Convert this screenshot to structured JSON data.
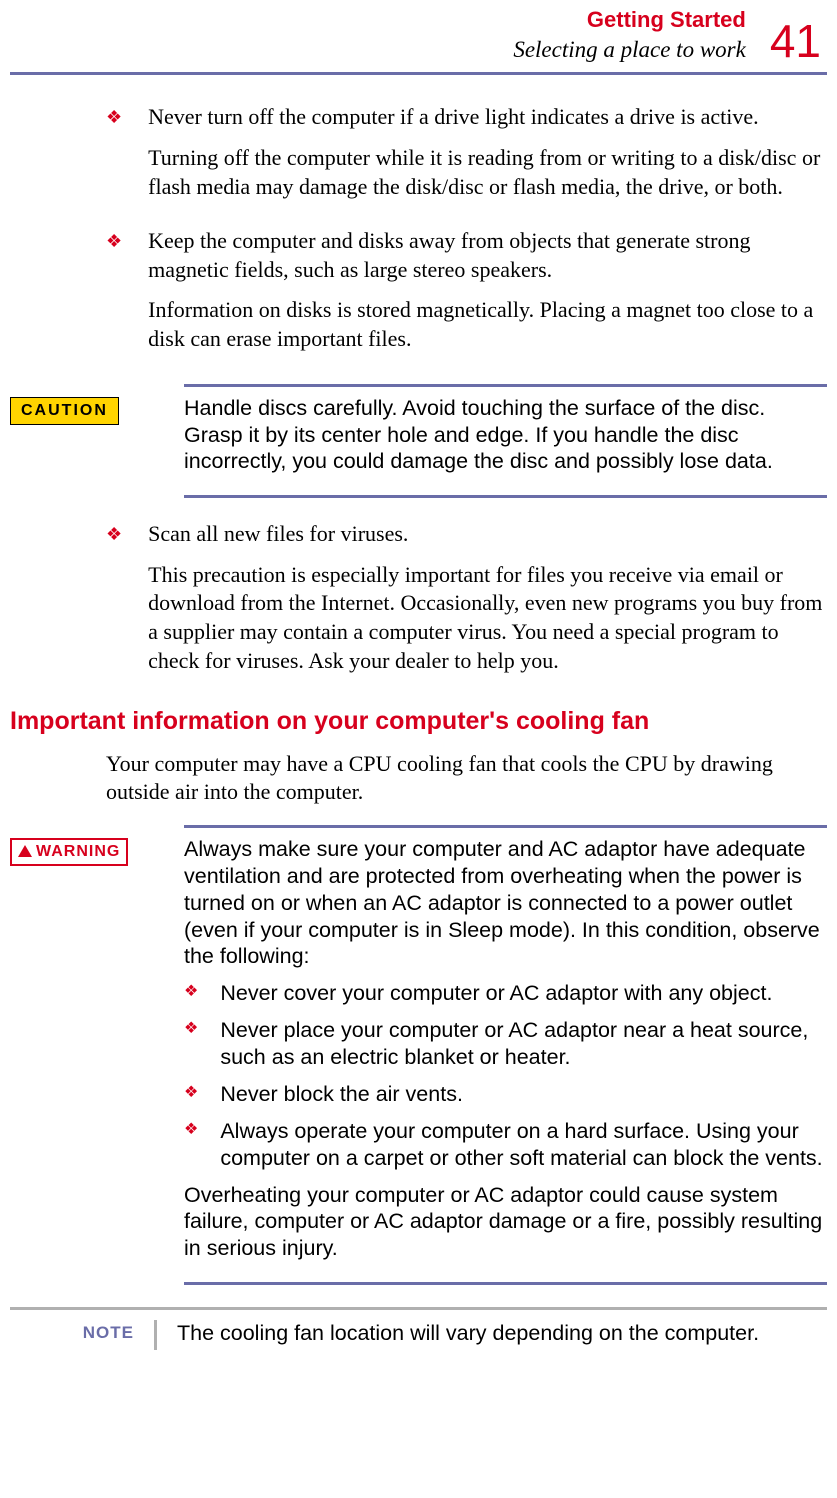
{
  "header": {
    "chapter": "Getting Started",
    "section": "Selecting a place to work",
    "page": "41"
  },
  "bullets1": [
    {
      "lead": "Never turn off the computer if a drive light indicates a drive is active.",
      "follow": "Turning off the computer while it is reading from or writing to a disk/disc or flash media may damage the disk/disc or flash media, the drive, or both."
    },
    {
      "lead": "Keep the computer and disks away from objects that generate strong magnetic fields, such as large stereo speakers.",
      "follow": "Information on disks is stored magnetically. Placing a magnet too close to a disk can erase important files."
    }
  ],
  "caution": {
    "label": "CAUTION",
    "text": "Handle discs carefully. Avoid touching the surface of the disc. Grasp it by its center hole and edge. If you handle the disc incorrectly, you could damage the disc and possibly lose data."
  },
  "bullets2": [
    {
      "lead": "Scan all new files for viruses.",
      "follow": "This precaution is especially important for files you receive via email or download from the Internet. Occasionally, even new programs you buy from a supplier may contain a computer virus. You need a special program to check for viruses. Ask your dealer to help you."
    }
  ],
  "heading": "Important information on your computer's cooling fan",
  "intro": "Your computer may have a CPU cooling fan that cools the CPU by drawing outside air into the computer.",
  "warning": {
    "label": "WARNING",
    "lead": "Always make sure your computer and AC adaptor have adequate ventilation and are protected from overheating when the power is turned on or when an AC adaptor is connected to a power outlet (even if your computer is in Sleep mode). In this condition, observe the following:",
    "items": [
      "Never cover your computer or AC adaptor with any object.",
      "Never place your computer or AC adaptor near a heat source, such as an electric blanket or heater.",
      "Never block the air vents.",
      "Always operate your computer on a hard surface. Using your computer on a carpet or other soft material can block the vents."
    ],
    "tail": "Overheating your computer or AC adaptor could cause system failure, computer or AC adaptor damage or a fire, possibly resulting in serious injury."
  },
  "note": {
    "label": "NOTE",
    "text": "The cooling fan location will vary depending on the computer."
  }
}
